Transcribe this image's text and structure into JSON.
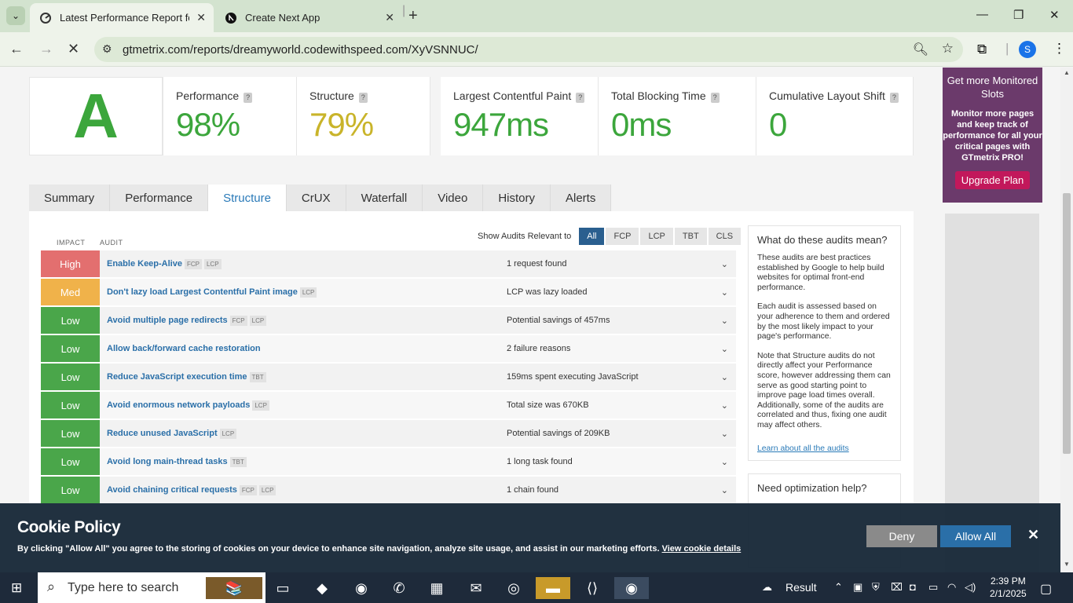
{
  "browser": {
    "tabs": [
      {
        "title": "Latest Performance Report for: ",
        "active": true
      },
      {
        "title": "Create Next App",
        "active": false
      }
    ],
    "url": "gtmetrix.com/reports/dreamyworld.codewithspeed.com/XyVSNNUC/",
    "profile_initial": "S"
  },
  "scores": {
    "grade": "A",
    "performance_label": "Performance",
    "performance_value": "98%",
    "structure_label": "Structure",
    "structure_value": "79%",
    "lcp_label": "Largest Contentful Paint",
    "lcp_value": "947ms",
    "tbt_label": "Total Blocking Time",
    "tbt_value": "0ms",
    "cls_label": "Cumulative Layout Shift",
    "cls_value": "0",
    "help_glyph": "?"
  },
  "promo": {
    "heading": "Get more Monitored Slots",
    "body": "Monitor more pages and keep track of performance for all your critical pages with GTmetrix PRO!",
    "button": "Upgrade Plan"
  },
  "report_tabs": [
    "Summary",
    "Performance",
    "Structure",
    "CrUX",
    "Waterfall",
    "Video",
    "History",
    "Alerts"
  ],
  "audits": {
    "impact_header": "IMPACT",
    "audit_header": "AUDIT",
    "filter_label": "Show Audits Relevant to",
    "filters": [
      "All",
      "FCP",
      "LCP",
      "TBT",
      "CLS"
    ],
    "rows": [
      {
        "impact": "High",
        "title": "Enable Keep-Alive",
        "tags": [
          "FCP",
          "LCP"
        ],
        "result": "1 request found"
      },
      {
        "impact": "Med",
        "title": "Don't lazy load Largest Contentful Paint image",
        "tags": [
          "LCP"
        ],
        "result": "LCP was lazy loaded"
      },
      {
        "impact": "Low",
        "title": "Avoid multiple page redirects",
        "tags": [
          "FCP",
          "LCP"
        ],
        "result": "Potential savings of 457ms"
      },
      {
        "impact": "Low",
        "title": "Allow back/forward cache restoration",
        "tags": [],
        "result": "2 failure reasons"
      },
      {
        "impact": "Low",
        "title": "Reduce JavaScript execution time",
        "tags": [
          "TBT"
        ],
        "result": "159ms spent executing JavaScript"
      },
      {
        "impact": "Low",
        "title": "Avoid enormous network payloads",
        "tags": [
          "LCP"
        ],
        "result": "Total size was 670KB"
      },
      {
        "impact": "Low",
        "title": "Reduce unused JavaScript",
        "tags": [
          "LCP"
        ],
        "result": "Potential savings of 209KB"
      },
      {
        "impact": "Low",
        "title": "Avoid long main-thread tasks",
        "tags": [
          "TBT"
        ],
        "result": "1 long task found"
      },
      {
        "impact": "Low",
        "title": "Avoid chaining critical requests",
        "tags": [
          "FCP",
          "LCP"
        ],
        "result": "1 chain found"
      }
    ]
  },
  "sidebar": {
    "title": "What do these audits mean?",
    "p1": "These audits are best practices established by Google to help build websites for optimal front-end performance.",
    "p2": "Each audit is assessed based on your adherence to them and ordered by the most likely impact to your page's performance.",
    "p3": "Note that Structure audits do not directly affect your Performance score, however addressing them can serve as good starting point to improve page load times overall. Additionally, some of the audits are correlated and thus, fixing one audit may affect others.",
    "link": "Learn about all the audits",
    "help_title": "Need optimization help?"
  },
  "cookie": {
    "title": "Cookie Policy",
    "desc": "By clicking \"Allow All\" you agree to the storing of cookies on your device to enhance site navigation, analyze site usage, and assist in our marketing efforts.",
    "link": "View cookie details",
    "deny": "Deny",
    "allow": "Allow All"
  },
  "taskbar": {
    "search_placeholder": "Type here to search",
    "weather": "Result",
    "time": "2:39 PM",
    "date": "2/1/2025"
  },
  "colors": {
    "accent": "#2a7ab8",
    "good": "#3ca63c",
    "warn": "#c9b42a",
    "high": "#e36f6f",
    "med": "#f0b24a",
    "low": "#4aa64a",
    "promo": "#6b3a6b"
  }
}
